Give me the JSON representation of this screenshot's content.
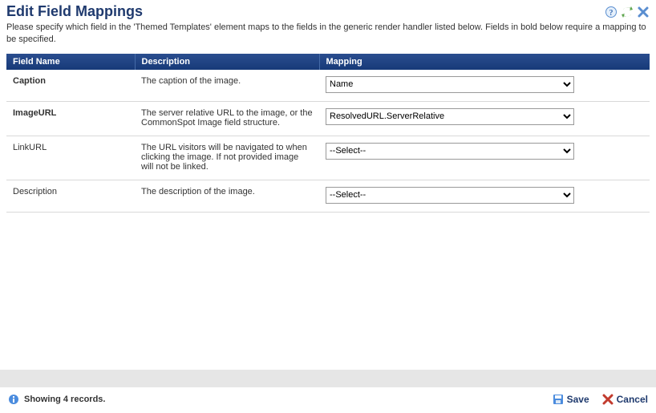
{
  "title": "Edit Field Mappings",
  "intro": "Please specify which field in the 'Themed Templates' element maps to the fields in the generic render handler listed below. Fields in bold below require a mapping to be specified.",
  "columns": {
    "field": "Field Name",
    "description": "Description",
    "mapping": "Mapping"
  },
  "rows": [
    {
      "field": "Caption",
      "required": true,
      "description": "The caption of the image.",
      "mapping": "Name"
    },
    {
      "field": "ImageURL",
      "required": true,
      "description": "The server relative URL to the image, or the CommonSpot Image field structure.",
      "mapping": "ResolvedURL.ServerRelative"
    },
    {
      "field": "LinkURL",
      "required": false,
      "description": "The URL visitors will be navigated to when clicking the image. If not provided image will not be linked.",
      "mapping": "--Select--"
    },
    {
      "field": "Description",
      "required": false,
      "description": "The description of the image.",
      "mapping": "--Select--"
    }
  ],
  "footer": {
    "records_text": "Showing 4 records.",
    "save_label": "Save",
    "cancel_label": "Cancel"
  }
}
